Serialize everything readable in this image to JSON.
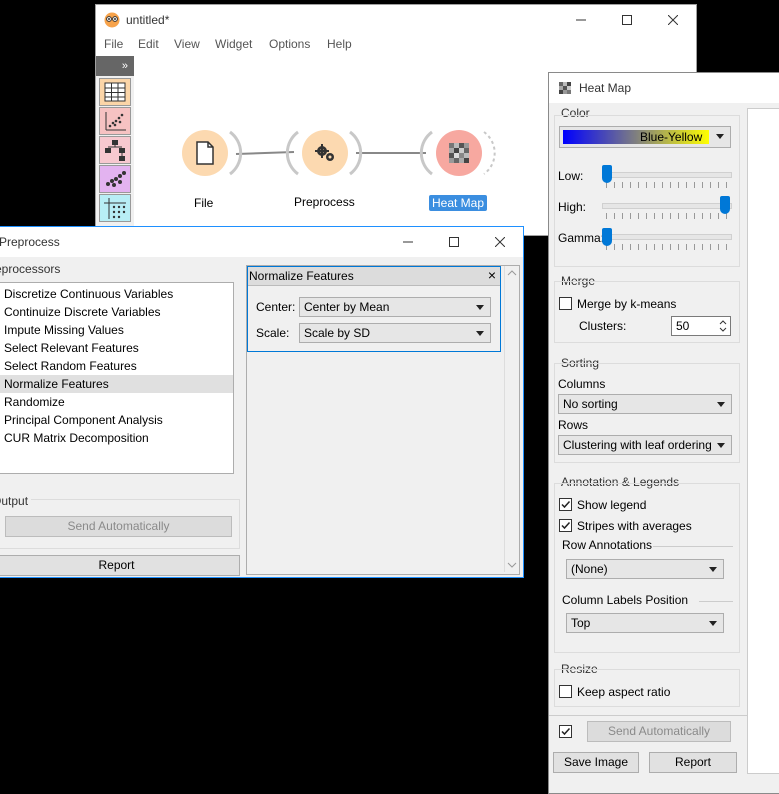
{
  "main_window": {
    "title": "untitled*",
    "menu": [
      "File",
      "Edit",
      "View",
      "Widget",
      "Options",
      "Help"
    ],
    "dock_toggle": "»",
    "dock_icons": [
      "data-table-icon",
      "scatter-plot-icon",
      "tree-icon",
      "scatter-dots-icon",
      "grid-icon"
    ],
    "nodes": [
      {
        "label": "File",
        "icon": "file-icon"
      },
      {
        "label": "Preprocess",
        "icon": "gears-icon"
      },
      {
        "label": "Heat Map",
        "icon": "heatmap-icon"
      }
    ]
  },
  "preprocess_window": {
    "title": "Preprocess",
    "preprocessors_title": "Preprocessors",
    "preprocessors": [
      "Discretize Continuous Variables",
      "Continuize Discrete Variables",
      "Impute Missing Values",
      "Select Relevant Features",
      "Select Random Features",
      "Normalize Features",
      "Randomize",
      "Principal Component Analysis",
      "CUR Matrix Decomposition"
    ],
    "selected_preprocessor": "Normalize Features",
    "output_title": "Output",
    "send_automatically": "Send Automatically",
    "report": "Report",
    "panel": {
      "title": "Normalize Features",
      "close": "×",
      "center_label": "Center:",
      "center_value": "Center by Mean",
      "scale_label": "Scale:",
      "scale_value": "Scale by SD"
    }
  },
  "heatmap_window": {
    "title": "Heat Map",
    "color": {
      "title": "Color",
      "palette": "Blue-Yellow",
      "palette_colors": [
        "#0000ff",
        "#ffff00"
      ],
      "low_label": "Low:",
      "low_value": 0.0,
      "high_label": "High:",
      "high_value": 1.0,
      "gamma_label": "Gamma:",
      "gamma_value": 0.0
    },
    "merge": {
      "title": "Merge",
      "kmeans_label": "Merge by k-means",
      "kmeans_checked": false,
      "clusters_label": "Clusters:",
      "clusters_value": "50"
    },
    "sorting": {
      "title": "Sorting",
      "columns_label": "Columns",
      "columns_value": "No sorting",
      "rows_label": "Rows",
      "rows_value": "Clustering with leaf ordering"
    },
    "annotation": {
      "title": "Annotation & Legends",
      "show_legend": "Show legend",
      "show_legend_checked": true,
      "stripes": "Stripes with averages",
      "stripes_checked": true,
      "row_annotations_label": "Row Annotations",
      "row_annotations_value": "(None)",
      "column_labels_label": "Column Labels Position",
      "column_labels_value": "Top"
    },
    "resize": {
      "title": "Resize",
      "keep_aspect": "Keep aspect ratio",
      "keep_aspect_checked": false
    },
    "auto_send_checked": true,
    "send_automatically": "Send Automatically",
    "save_image": "Save Image",
    "report": "Report"
  },
  "colors": {
    "accent": "#0078d7",
    "node_fill": "#fcd9b0",
    "heatmap_node_fill": "#f7a8a0",
    "dock_colors": [
      "#fbd5a8",
      "#f6c2c2",
      "#f7c8cf",
      "#e3b3f0",
      "#b8eef5"
    ]
  }
}
